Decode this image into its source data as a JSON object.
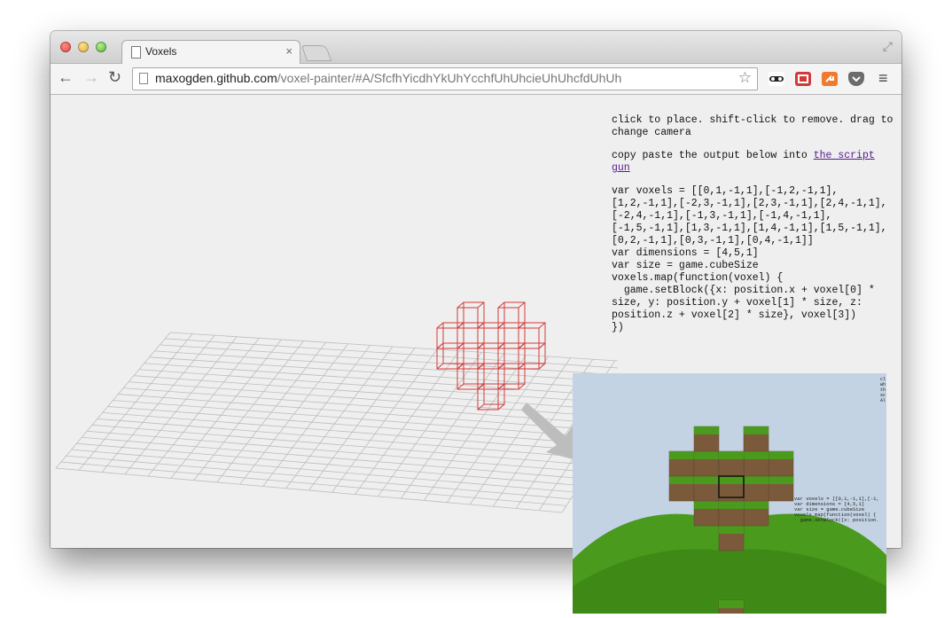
{
  "browser": {
    "tab_title": "Voxels",
    "tab_close": "×",
    "url_host": "maxogden.github.com",
    "url_rest": "/voxel-painter/#A/SfcfhYicdhYkUhYcchfUhUhcieUhUhcfdUhUh",
    "back_glyph": "←",
    "forward_glyph": "→",
    "reload_glyph": "↻",
    "star_glyph": "☆",
    "menu_glyph": "≡",
    "fullscreen_glyph": "⤢"
  },
  "instructions": {
    "line1": "click to place. shift-click to remove. drag to change camera",
    "line2_prefix": "copy paste the output below into ",
    "line2_link": "the script gun"
  },
  "code_output": "var voxels = [[0,1,-1,1],[-1,2,-1,1],\n[1,2,-1,1],[-2,3,-1,1],[2,3,-1,1],[2,4,-1,1],\n[-2,4,-1,1],[-1,3,-1,1],[-1,4,-1,1],\n[-1,5,-1,1],[1,3,-1,1],[1,4,-1,1],[1,5,-1,1],\n[0,2,-1,1],[0,3,-1,1],[0,4,-1,1]]\nvar dimensions = [4,5,1]\nvar size = game.cubeSize\nvoxels.map(function(voxel) {\n  game.setBlock({x: position.x + voxel[0] *\nsize, y: position.y + voxel[1] * size, z:\nposition.z + voxel[2] * size}, voxel[3])\n})",
  "inset": {
    "code": "var voxels = [[0,1,-1,1],[-1,\nvar dimensions = [4,5,1]\nvar size = game.cubeSize\nvoxels.map(function(voxel) {\n  game.setBlock({x: position.",
    "top_text": "cl\nwh\nth\nsc\nAl"
  },
  "colors": {
    "voxel_outline": "#d63a3a",
    "grid": "#bdbdbd",
    "sky": "#c3d3e4",
    "grass": "#4a9a1e",
    "dirt": "#7a5a3a"
  },
  "icons": [
    "page-icon",
    "back-icon",
    "forward-icon",
    "reload-icon",
    "star-icon",
    "incognito-icon",
    "extension-icon",
    "share-icon",
    "pocket-icon",
    "menu-icon",
    "arrow-icon"
  ]
}
